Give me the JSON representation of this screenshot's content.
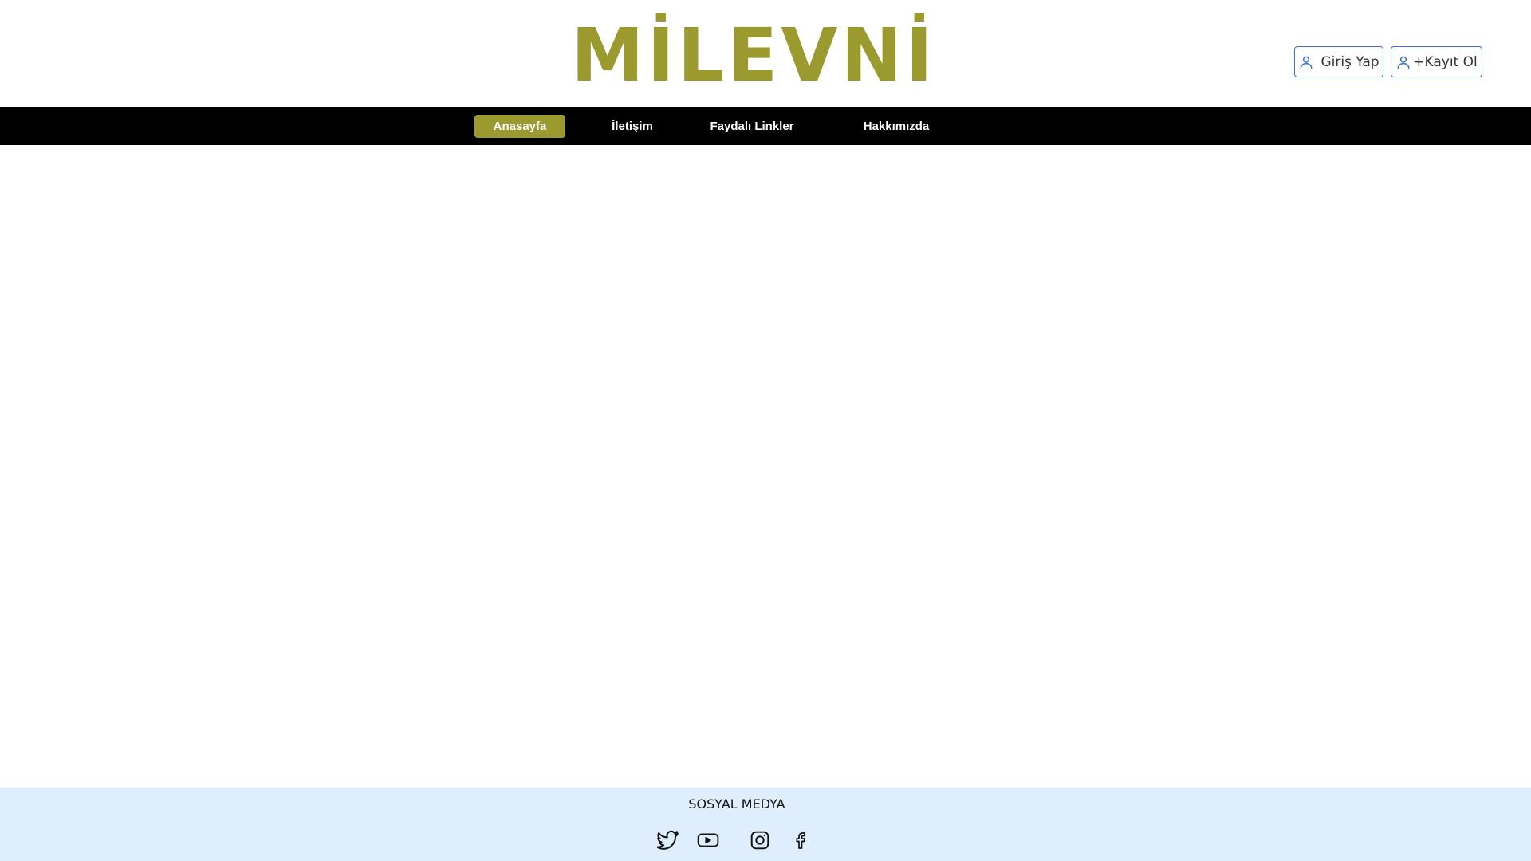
{
  "header": {
    "logo_text": "MİLEVNİ",
    "login_label": "Giriş Yap",
    "register_label": "+Kayıt Ol"
  },
  "nav": {
    "items": [
      {
        "label": "Anasayfa",
        "active": true
      },
      {
        "label": "İletişim",
        "active": false
      },
      {
        "label": "Faydalı Linkler",
        "active": false
      },
      {
        "label": "Hakkımızda",
        "active": false
      }
    ]
  },
  "footer": {
    "title": "SOSYAL MEDYA",
    "social_icons": [
      "twitter-icon",
      "youtube-icon",
      "instagram-icon",
      "facebook-icon"
    ]
  },
  "colors": {
    "brand": "#9a9a2e",
    "navbar_bg": "#000000",
    "footer_bg": "#dfeefc",
    "button_border": "#3a6fd8"
  }
}
